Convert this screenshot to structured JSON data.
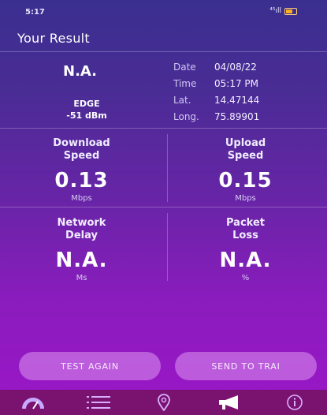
{
  "status_bar": {
    "time": "5:17",
    "signal": "⁴⁵ıll"
  },
  "header": {
    "title": "Your Result"
  },
  "summary": {
    "operator": "N.A.",
    "technology": "EDGE",
    "signal_strength": "-51 dBm"
  },
  "details": [
    {
      "key": "Date",
      "value": "04/08/22"
    },
    {
      "key": "Time",
      "value": "05:17 PM"
    },
    {
      "key": "Lat.",
      "value": "14.47144"
    },
    {
      "key": "Long.",
      "value": "75.89901"
    }
  ],
  "metrics": {
    "download": {
      "label_line1": "Download",
      "label_line2": "Speed",
      "value": "0.13",
      "unit": "Mbps"
    },
    "upload": {
      "label_line1": "Upload",
      "label_line2": "Speed",
      "value": "0.15",
      "unit": "Mbps"
    },
    "delay": {
      "label_line1": "Network",
      "label_line2": "Delay",
      "value": "N.A.",
      "unit": "Ms"
    },
    "loss": {
      "label_line1": "Packet",
      "label_line2": "Loss",
      "value": "N.A.",
      "unit": "%"
    }
  },
  "actions": {
    "test_again": "TEST AGAIN",
    "send": "SEND TO TRAI"
  },
  "nav": {
    "items": [
      "speedometer-icon",
      "list-icon",
      "location-pin-icon",
      "megaphone-icon",
      "info-icon"
    ],
    "active": "megaphone-icon"
  },
  "colors": {
    "nav_bg": "#7a1270",
    "button_bg": "#d896f0",
    "gradient_top": "#3a2f8f",
    "gradient_bottom": "#9b16c8"
  }
}
